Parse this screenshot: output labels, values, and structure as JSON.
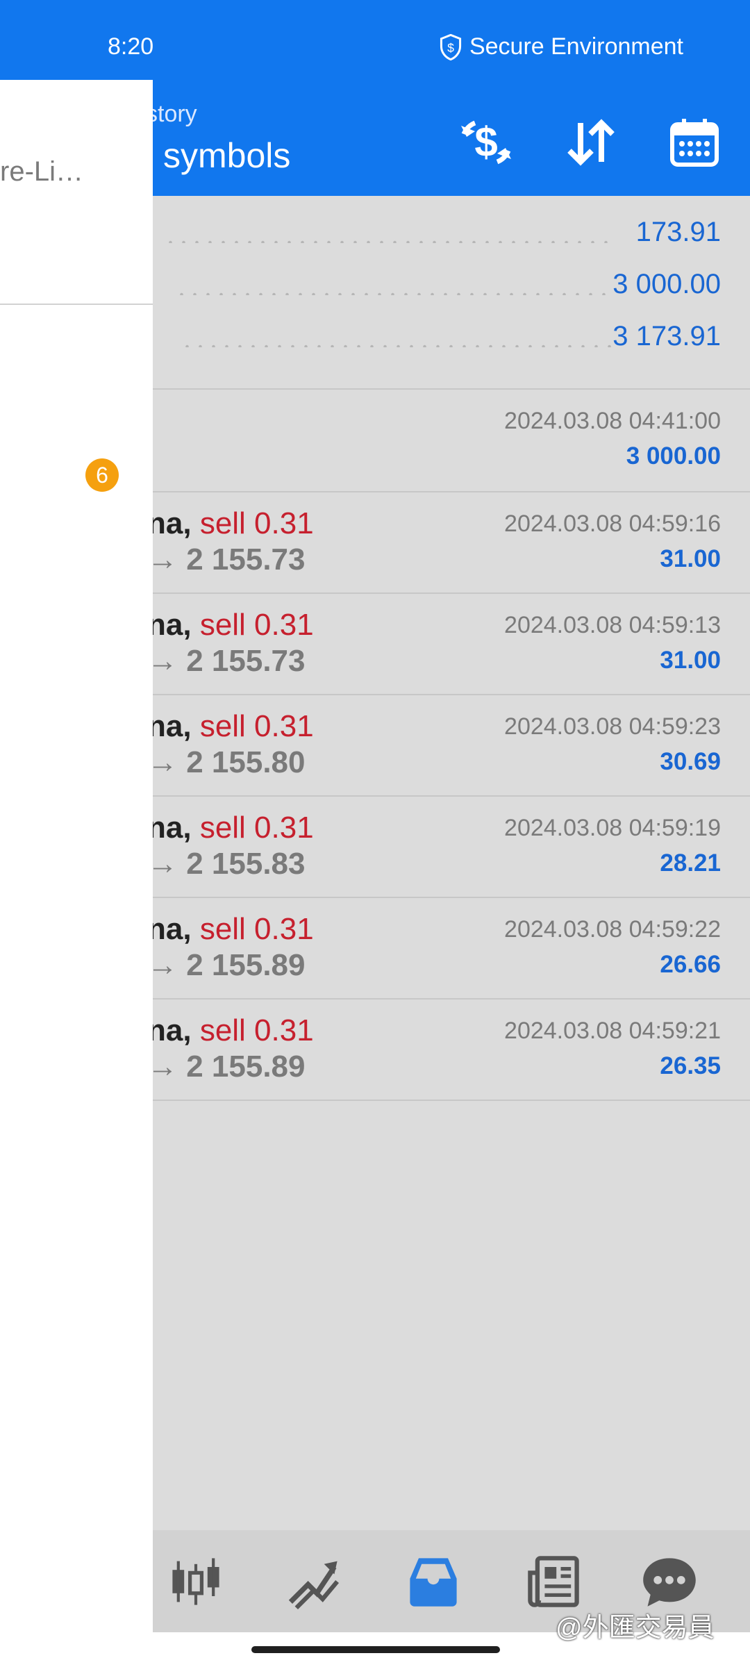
{
  "status": {
    "time": "8:20",
    "secure_label": "Secure Environment"
  },
  "header": {
    "subtitle": "story",
    "title": "l symbols"
  },
  "summary": {
    "rows": [
      {
        "value": "173.91"
      },
      {
        "value": "3 000.00"
      },
      {
        "value": "3 173.91"
      }
    ]
  },
  "balance": {
    "time": "2024.03.08 04:41:00",
    "amount": "3 000.00"
  },
  "deals": [
    {
      "symbol": "na,",
      "action": "sell 0.31",
      "price": "→ 2 155.73",
      "time": "2024.03.08 04:59:16",
      "profit": "31.00"
    },
    {
      "symbol": "na,",
      "action": "sell 0.31",
      "price": "→ 2 155.73",
      "time": "2024.03.08 04:59:13",
      "profit": "31.00"
    },
    {
      "symbol": "na,",
      "action": "sell 0.31",
      "price": "→ 2 155.80",
      "time": "2024.03.08 04:59:23",
      "profit": "30.69"
    },
    {
      "symbol": "na,",
      "action": "sell 0.31",
      "price": "→ 2 155.83",
      "time": "2024.03.08 04:59:19",
      "profit": "28.21"
    },
    {
      "symbol": "na,",
      "action": "sell 0.31",
      "price": "→ 2 155.89",
      "time": "2024.03.08 04:59:22",
      "profit": "26.66"
    },
    {
      "symbol": "na,",
      "action": "sell 0.31",
      "price": "→ 2 155.89",
      "time": "2024.03.08 04:59:21",
      "profit": "26.35"
    }
  ],
  "drawer": {
    "item1": "re-Li…",
    "badge": "6"
  },
  "bottom_nav": {
    "items": [
      {
        "icon": "candlestick-icon"
      },
      {
        "icon": "trade-chart-icon"
      },
      {
        "icon": "history-inbox-icon",
        "active": true
      },
      {
        "icon": "news-icon"
      },
      {
        "icon": "chat-icon"
      }
    ]
  },
  "watermark": "@外匯交易員",
  "colors": {
    "primary": "#1177ee",
    "profit": "#1966d2",
    "sell": "#c6202e",
    "badge": "#f5a00f",
    "muted": "#7a7a7a"
  }
}
